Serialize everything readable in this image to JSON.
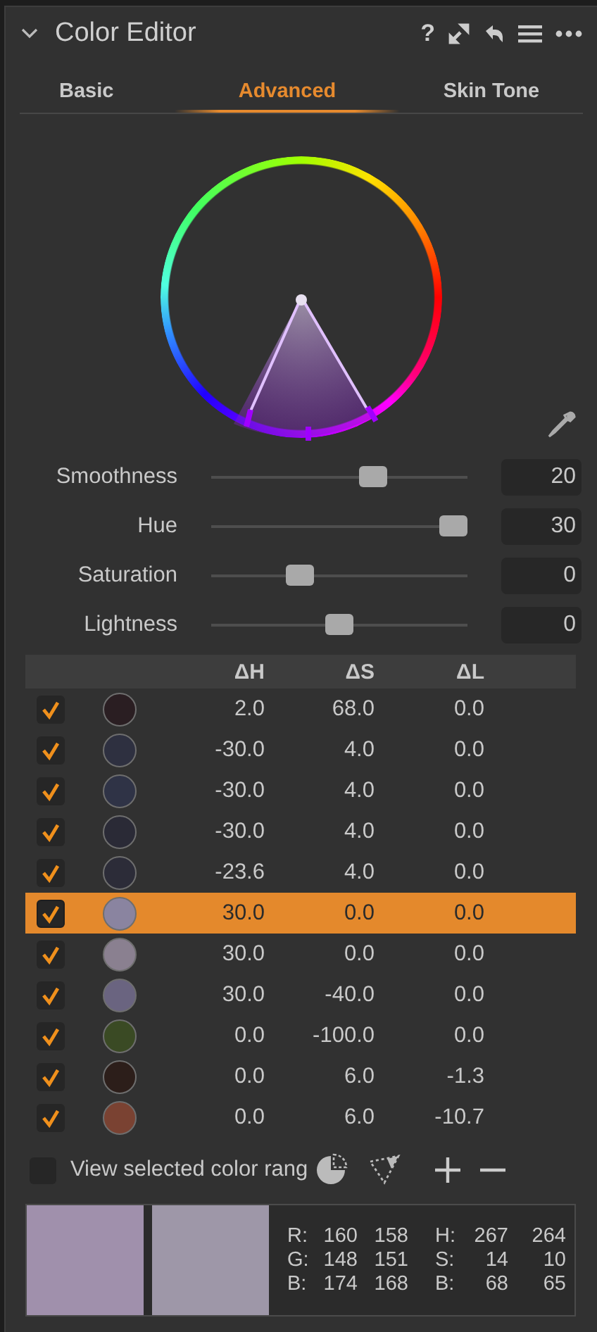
{
  "header": {
    "title": "Color Editor",
    "expanded": true,
    "help": "?"
  },
  "tabs": [
    {
      "label": "Basic",
      "selected": false
    },
    {
      "label": "Advanced",
      "selected": true
    },
    {
      "label": "Skin Tone",
      "selected": false
    }
  ],
  "sliders": [
    {
      "label": "Smoothness",
      "level": 0.65,
      "value": "20"
    },
    {
      "label": "Hue",
      "level": 1.0,
      "value": "30"
    },
    {
      "label": "Saturation",
      "level": 0.33,
      "value": "0"
    },
    {
      "label": "Lightness",
      "level": 0.5,
      "value": "0"
    }
  ],
  "table": {
    "columns": [
      "ΔH",
      "ΔS",
      "ΔL"
    ],
    "rows": [
      {
        "checked": true,
        "selected": false,
        "color": "#2a1e22",
        "cells": [
          "2.0",
          "68.0",
          "0.0"
        ]
      },
      {
        "checked": true,
        "selected": false,
        "color": "#2e3040",
        "cells": [
          "-30.0",
          "4.0",
          "0.0"
        ]
      },
      {
        "checked": true,
        "selected": false,
        "color": "#2f3346",
        "cells": [
          "-30.0",
          "4.0",
          "0.0"
        ]
      },
      {
        "checked": true,
        "selected": false,
        "color": "#2a2a36",
        "cells": [
          "-30.0",
          "4.0",
          "0.0"
        ]
      },
      {
        "checked": true,
        "selected": false,
        "color": "#2c2c38",
        "cells": [
          "-23.6",
          "4.0",
          "0.0"
        ]
      },
      {
        "checked": true,
        "selected": true,
        "color": "#8a84a0",
        "cells": [
          "30.0",
          "0.0",
          "0.0"
        ]
      },
      {
        "checked": true,
        "selected": false,
        "color": "#8a8090",
        "cells": [
          "30.0",
          "0.0",
          "0.0"
        ]
      },
      {
        "checked": true,
        "selected": false,
        "color": "#6a6480",
        "cells": [
          "30.0",
          "-40.0",
          "0.0"
        ]
      },
      {
        "checked": true,
        "selected": false,
        "color": "#3a4a24",
        "cells": [
          "0.0",
          "-100.0",
          "0.0"
        ]
      },
      {
        "checked": true,
        "selected": false,
        "color": "#2c1e1a",
        "cells": [
          "0.0",
          "6.0",
          "-1.3"
        ]
      },
      {
        "checked": true,
        "selected": false,
        "color": "#7a4232",
        "cells": [
          "0.0",
          "6.0",
          "-10.7"
        ]
      }
    ]
  },
  "view_range": {
    "label": "View selected color rang",
    "checked": false
  },
  "swatches": [
    {
      "color": "#a090ac"
    },
    {
      "color": "#9e97a8"
    }
  ],
  "readout": {
    "rgb": [
      {
        "label": "R:",
        "values": [
          "160",
          "158"
        ]
      },
      {
        "label": "G:",
        "values": [
          "148",
          "151"
        ]
      },
      {
        "label": "B:",
        "values": [
          "174",
          "168"
        ]
      }
    ],
    "hsb": [
      {
        "label": "H:",
        "values": [
          "267",
          "264"
        ]
      },
      {
        "label": "S:",
        "values": [
          "14",
          "10"
        ]
      },
      {
        "label": "B:",
        "values": [
          "68",
          "65"
        ]
      }
    ]
  }
}
